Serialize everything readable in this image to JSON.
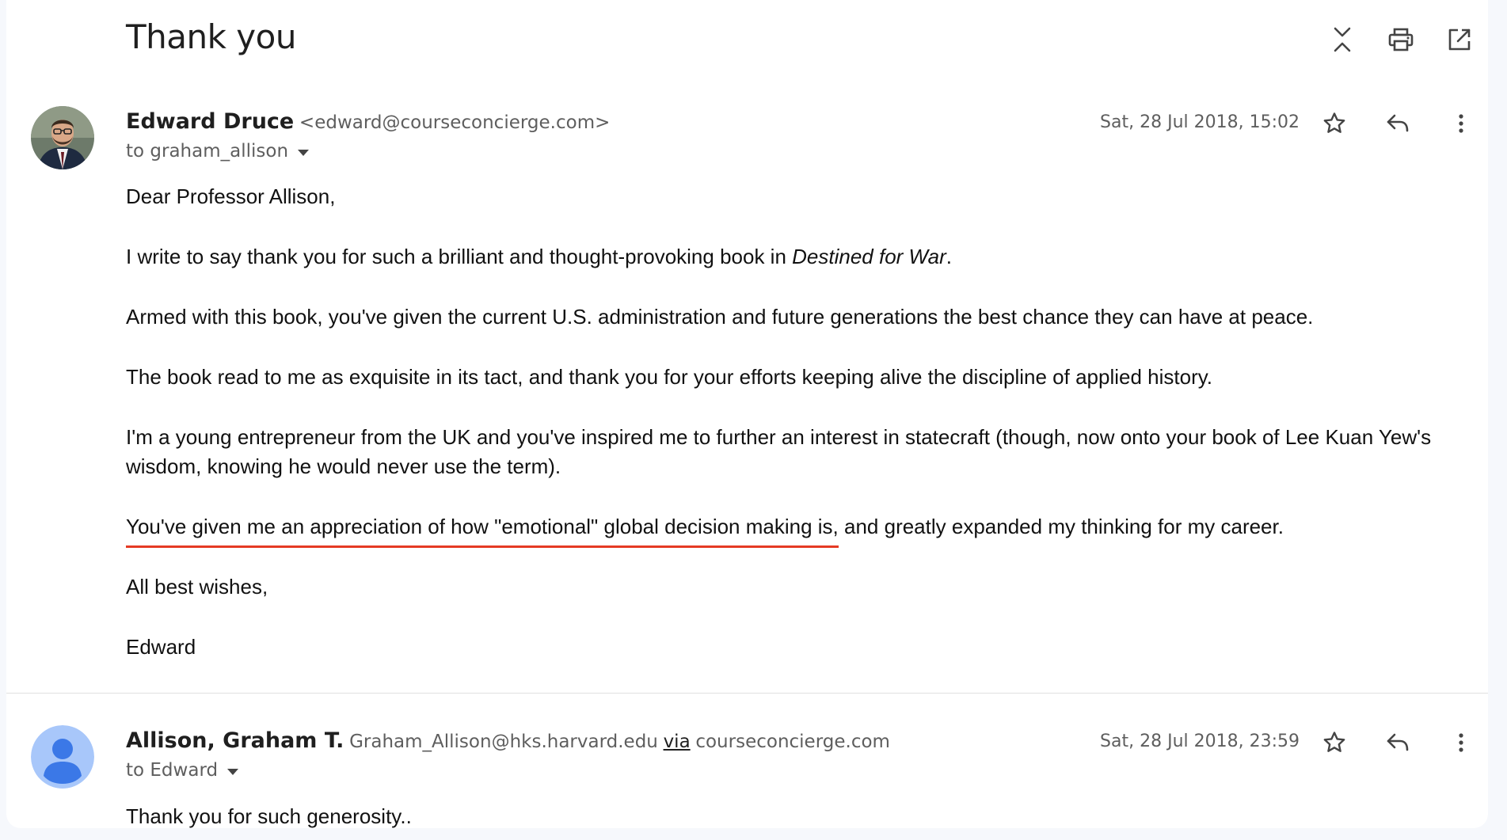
{
  "thread": {
    "title": "Thank you"
  },
  "top_actions": {
    "collapse_icon": "collapse-all-icon",
    "print_icon": "print-icon",
    "open_new_window_icon": "open-in-new-window-icon"
  },
  "messages": [
    {
      "sender_name": "Edward Druce",
      "sender_email": "<edward@courseconcierge.com>",
      "recipient": "to graham_allison",
      "date": "Sat, 28 Jul 2018, 15:02",
      "body": {
        "p1": "Dear Professor Allison,",
        "p2_before": "I write to say thank you for such a brilliant and thought-provoking book in ",
        "p2_em": "Destined for War",
        "p2_after": ".",
        "p3": "Armed with this book, you've given the current U.S. administration and future generations the best chance they can have at peace.",
        "p4": "The book read to me as exquisite in its tact, and thank you for your efforts keeping alive the discipline of applied history.",
        "p5": "I'm a young entrepreneur from the UK and you've inspired me to further an interest in statecraft (though, now onto your book of Lee Kuan Yew's wisdom, knowing he would never use the term).",
        "p6_highlighted": "You've given me an appreciation of how \"emotional\" global decision making is,",
        "p6_rest": " and greatly expanded my thinking for my career.",
        "p7": "All best wishes,",
        "p8": "Edward"
      }
    },
    {
      "sender_name": "Allison, Graham T.",
      "sender_email": "Graham_Allison@hks.harvard.edu",
      "via_label": "via",
      "via_domain": "courseconcierge.com",
      "recipient": "to Edward",
      "date": "Sat, 28 Jul 2018, 23:59",
      "body": "Thank you for such generosity.."
    }
  ],
  "colors": {
    "highlight_underline": "#e53a24",
    "default_avatar_bg": "#a8c7fa",
    "default_avatar_fg": "#3b78e7"
  }
}
